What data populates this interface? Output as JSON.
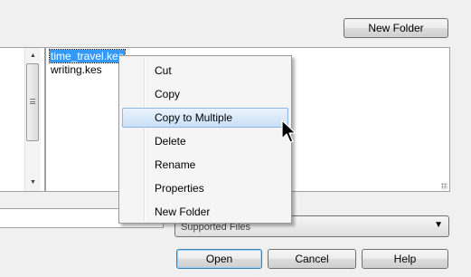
{
  "toolbar": {
    "new_folder_label": "New Folder"
  },
  "files": [
    {
      "name": "time_travel.kes",
      "selected": true
    },
    {
      "name": "writing.kes",
      "selected": false
    }
  ],
  "scrollbar": {
    "up_glyph": "▲",
    "down_glyph": "▼"
  },
  "file_type": {
    "value": "Supported Files",
    "arrow": "▼"
  },
  "buttons": {
    "open": "Open",
    "cancel": "Cancel",
    "help": "Help"
  },
  "context_menu": {
    "items": [
      {
        "label": "Cut"
      },
      {
        "label": "Copy"
      },
      {
        "label": "Copy to Multiple",
        "highlighted": true
      },
      {
        "label": "Delete"
      },
      {
        "label": "Rename"
      },
      {
        "label": "Properties"
      },
      {
        "label": "New Folder"
      }
    ]
  },
  "colors": {
    "selection": "#3399ff",
    "menu_highlight": "#c9e0f7",
    "dialog_bg": "#f0f0f0"
  }
}
